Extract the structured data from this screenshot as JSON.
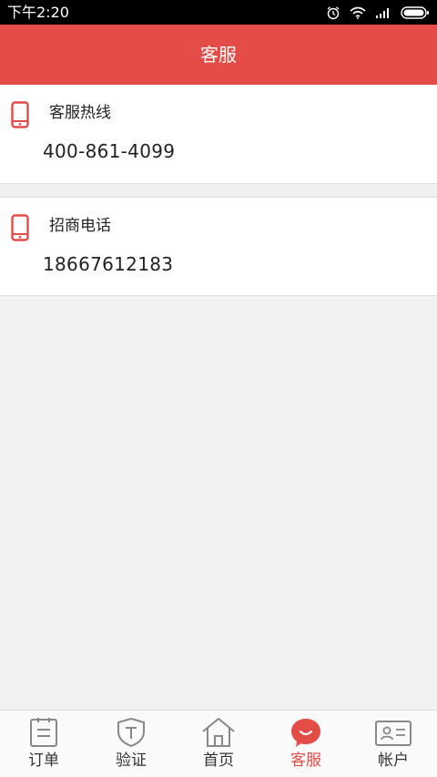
{
  "status_bar": {
    "time": "下午2:20",
    "icons": [
      "alarm-icon",
      "wifi-icon",
      "signal-icon",
      "battery-icon"
    ]
  },
  "header": {
    "title": "客服"
  },
  "contacts": [
    {
      "label": "客服热线",
      "value": "400-861-4099",
      "icon": "phone-icon"
    },
    {
      "label": "招商电话",
      "value": "18667612183",
      "icon": "phone-icon"
    }
  ],
  "tabs": [
    {
      "label": "订单",
      "icon": "order-icon",
      "active": false
    },
    {
      "label": "验证",
      "icon": "shield-icon",
      "active": false
    },
    {
      "label": "首页",
      "icon": "home-icon",
      "active": false
    },
    {
      "label": "客服",
      "icon": "chat-bubble-icon",
      "active": true
    },
    {
      "label": "帐户",
      "icon": "id-card-icon",
      "active": false
    }
  ],
  "colors": {
    "accent": "#e44c48",
    "background": "#f1f1f1",
    "status_bar": "#000000",
    "inactive_icon": "#888888"
  }
}
